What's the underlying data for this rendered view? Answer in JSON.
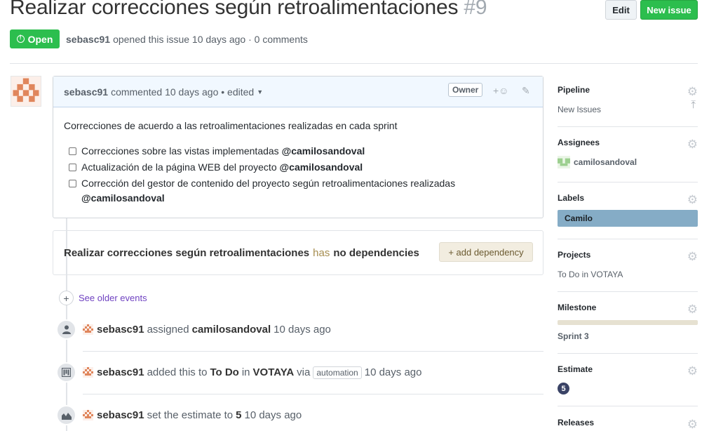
{
  "issue": {
    "title": "Realizar correcciones según retroalimentaciones",
    "number": "#9",
    "state": "Open",
    "author": "sebasc91",
    "opened_text": "opened this issue 10 days ago · 0 comments"
  },
  "header_buttons": {
    "edit": "Edit",
    "new_issue": "New issue"
  },
  "comment": {
    "author": "sebasc91",
    "meta": "commented 10 days ago • edited",
    "owner_badge": "Owner",
    "reaction_icon": "smiley-icon",
    "edit_icon": "pencil-icon",
    "intro": "Correcciones de acuerdo a las retroalimentaciones realizadas en cada sprint",
    "tasks": [
      {
        "text": "Correcciones sobre las vistas implementadas",
        "mention": "@camilosandoval"
      },
      {
        "text": "Actualización de la página WEB del proyecto",
        "mention": "@camilosandoval"
      },
      {
        "text": "Corrección del gestor de contenido del proyecto según retroalimentaciones realizadas",
        "mention": "@camilosandoval"
      }
    ]
  },
  "dependencies": {
    "issue_title": "Realizar correcciones según retroalimentaciones",
    "has": "has",
    "status": "no dependencies",
    "add_button": "+ add dependency"
  },
  "timeline": {
    "see_older": "See older events",
    "events": [
      {
        "icon": "person-icon",
        "actor": "sebasc91",
        "parts": [
          "assigned",
          "camilosandoval",
          "10 days ago"
        ]
      },
      {
        "icon": "board-icon",
        "actor": "sebasc91",
        "parts": [
          "added this to",
          "To Do",
          "in",
          "VOTAYA",
          "via",
          "automation",
          "10 days ago"
        ]
      },
      {
        "icon": "graph-icon",
        "actor": "sebasc91",
        "parts": [
          "set the estimate to",
          "5",
          "10 days ago"
        ]
      }
    ]
  },
  "sidebar": {
    "pipeline": {
      "heading": "Pipeline",
      "value": "New Issues"
    },
    "assignees": {
      "heading": "Assignees",
      "value": "camilosandoval"
    },
    "labels": {
      "heading": "Labels",
      "value": "Camilo",
      "color": "#85acc6"
    },
    "projects": {
      "heading": "Projects",
      "value": "To Do in VOTAYA"
    },
    "milestone": {
      "heading": "Milestone",
      "value": "Sprint 3"
    },
    "estimate": {
      "heading": "Estimate",
      "value": "5"
    },
    "releases": {
      "heading": "Releases"
    }
  }
}
